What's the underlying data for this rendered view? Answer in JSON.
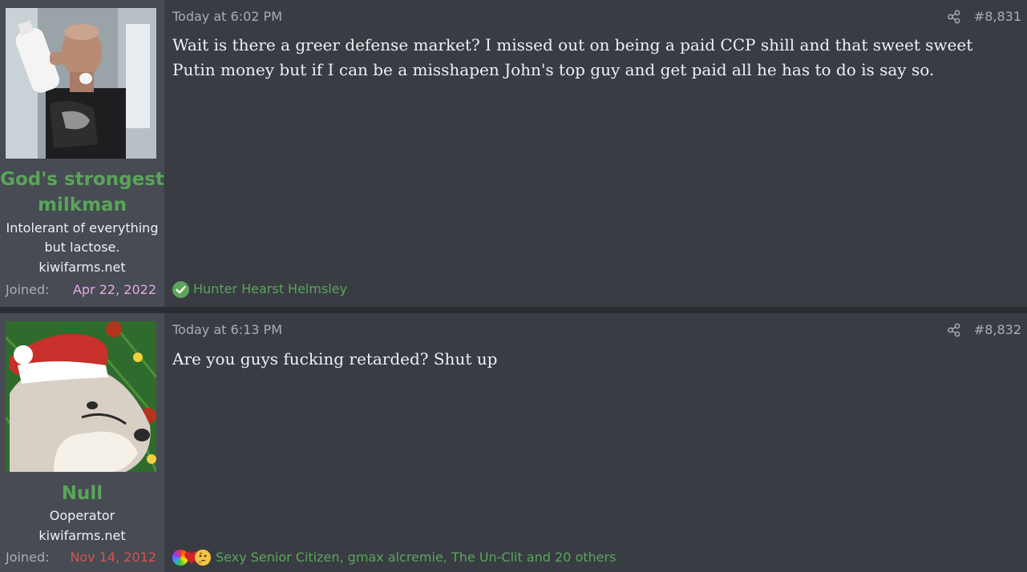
{
  "posts": [
    {
      "date": "Today at 6:02 PM",
      "post_number": "#8,831",
      "username": "God's strongest milkman",
      "user_title": "Intolerant of everything but lactose.",
      "user_banner": "kiwifarms.net",
      "joined_label": "Joined:",
      "joined_date": "Apr 22, 2022",
      "message": "Wait is there a greer defense market? I missed out on being a paid CCP shill and that sweet sweet Putin money but if I can be a misshapen John's top guy and get paid all he has to do is say so.",
      "reactions_text": "Hunter Hearst Helmsley",
      "reaction_icons": [
        "check-icon"
      ],
      "joined_color": "#e7a6e7"
    },
    {
      "date": "Today at 6:13 PM",
      "post_number": "#8,832",
      "username": "Null",
      "user_title": "Ooperator",
      "user_banner": "kiwifarms.net",
      "joined_label": "Joined:",
      "joined_date": "Nov 14, 2012",
      "message": "Are you guys fucking retarded? Shut up",
      "reactions_text": "Sexy Senior Citizen, gmax alcremie, The Un-Clit and 20 others",
      "reaction_icons": [
        "rainbow-icon",
        "heart-icon",
        "thinking-icon"
      ],
      "joined_color": "#d9534f"
    }
  ],
  "colors": {
    "username": "#5aa55a",
    "background": "#393c43",
    "sidebar": "#474b53",
    "meta_text": "#a9adb4"
  }
}
